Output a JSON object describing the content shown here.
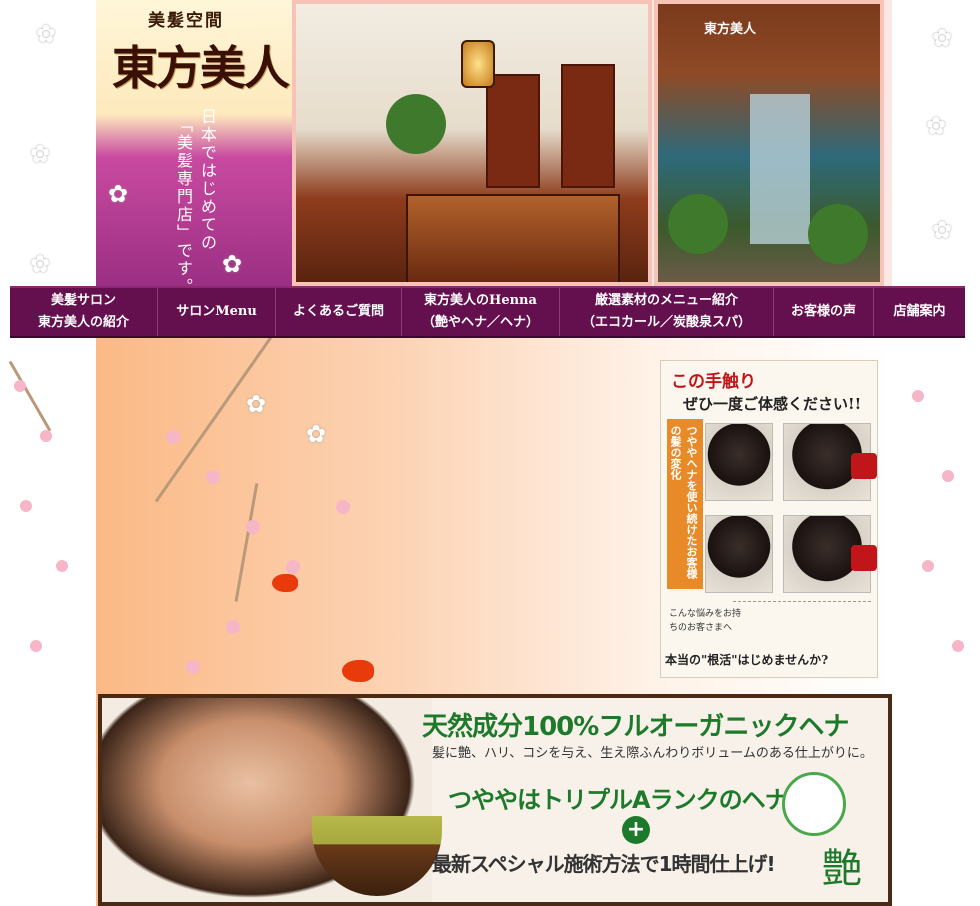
{
  "header": {
    "logo_sub": "美髪空間",
    "logo_main": "東方美人",
    "tagline_line1": "日本ではじめての",
    "tagline_line2": "「美髪専門店」です。",
    "storefront_sign": "東方美人"
  },
  "nav": {
    "items": [
      {
        "line1": "美髪サロン",
        "line2": "東方美人の紹介"
      },
      {
        "line1": "サロンMenu",
        "line2": ""
      },
      {
        "line1": "よくあるご質問",
        "line2": ""
      },
      {
        "line1": "東方美人のHenna",
        "line2": "（艶やヘナ／ヘナ）"
      },
      {
        "line1": "厳選素材のメニュー紹介",
        "line2": "（エコカール／炭酸泉スパ）"
      },
      {
        "line1": "お客様の声",
        "line2": ""
      },
      {
        "line1": "店舗案内",
        "line2": ""
      }
    ]
  },
  "flyer": {
    "title": "この手触り",
    "subtitle": "ぜひ一度ご体感ください!!",
    "vertical": "つややヘナを使い続けたお客様の髪の変化",
    "worry_label": "こんな悩みをお持ちのお客さまへ",
    "footer": "本当の\"根活\"はじめませんか?"
  },
  "banner": {
    "title": "天然成分100%フルオーガニックヘナ",
    "desc": "髪に艶、ハリ、コシを与え、生え際ふんわりボリュームのある仕上がりに。",
    "rank": "つややはトリプルAランクのヘナ",
    "plus": "+",
    "method": "最新スペシャル施術方法で1時間仕上げ!",
    "logo": "艶"
  },
  "colors": {
    "nav_bg": "#64104e",
    "accent_green": "#1d7a2a",
    "accent_red": "#c0161a"
  }
}
